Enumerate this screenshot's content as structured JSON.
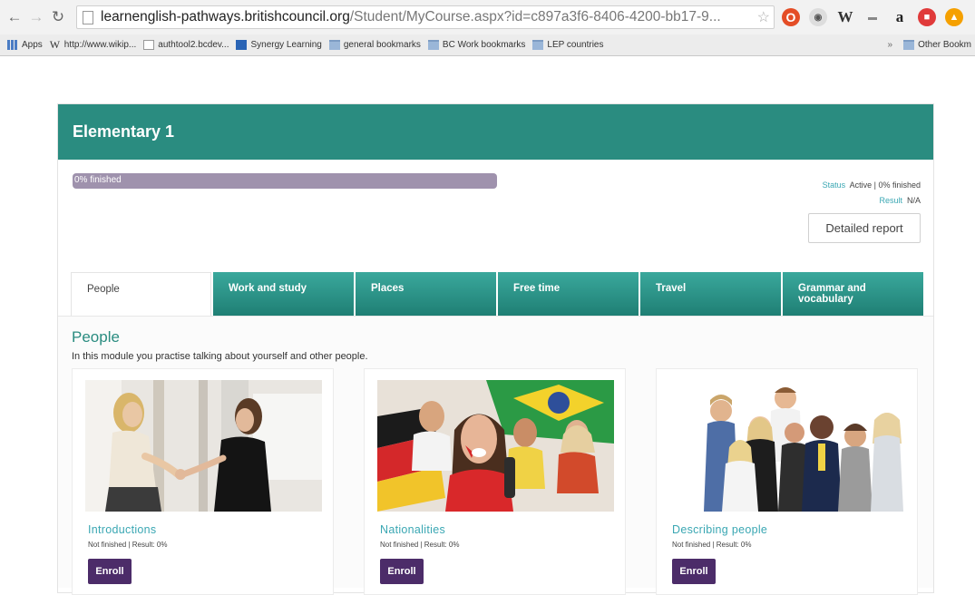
{
  "browser": {
    "url_host": "learnenglish-pathways.britishcouncil.org",
    "url_path": "/Student/MyCourse.aspx?id=c897a3f6-8406-4200-bb17-9...",
    "bookmarks": [
      {
        "label": "Apps",
        "icon": "apps-icon"
      },
      {
        "label": "http://www.wikip...",
        "icon": "wikipedia-icon"
      },
      {
        "label": "authtool2.bcdev...",
        "icon": "page-icon"
      },
      {
        "label": "Synergy Learning",
        "icon": "synergy-icon"
      },
      {
        "label": "general bookmarks",
        "icon": "folder-icon"
      },
      {
        "label": "BC Work bookmarks",
        "icon": "folder-icon"
      },
      {
        "label": "LEP countries",
        "icon": "folder-icon"
      }
    ],
    "other_bookmarks": "Other Bookm"
  },
  "course": {
    "title": "Elementary 1",
    "progress_label": "0% finished",
    "progress_percent": 0,
    "status_key": "Status",
    "status_value": "Active | 0% finished",
    "result_key": "Result",
    "result_value": "N/A",
    "report_label": "Detailed report",
    "header_color": "#2a8c80",
    "enroll_color": "#4c2c69"
  },
  "tabs": [
    "People",
    "Work and study",
    "Places",
    "Free time",
    "Travel",
    "Grammar and vocabulary"
  ],
  "module": {
    "title": "People",
    "description": "In this module you practise talking about yourself and other people."
  },
  "lessons": [
    {
      "title": "Introductions",
      "meta": "Not finished  |  Result: 0%",
      "button": "Enroll"
    },
    {
      "title": "Nationalities",
      "meta": "Not finished  |  Result: 0%",
      "button": "Enroll"
    },
    {
      "title": "Describing people",
      "meta": "Not finished  |  Result: 0%",
      "button": "Enroll"
    }
  ]
}
